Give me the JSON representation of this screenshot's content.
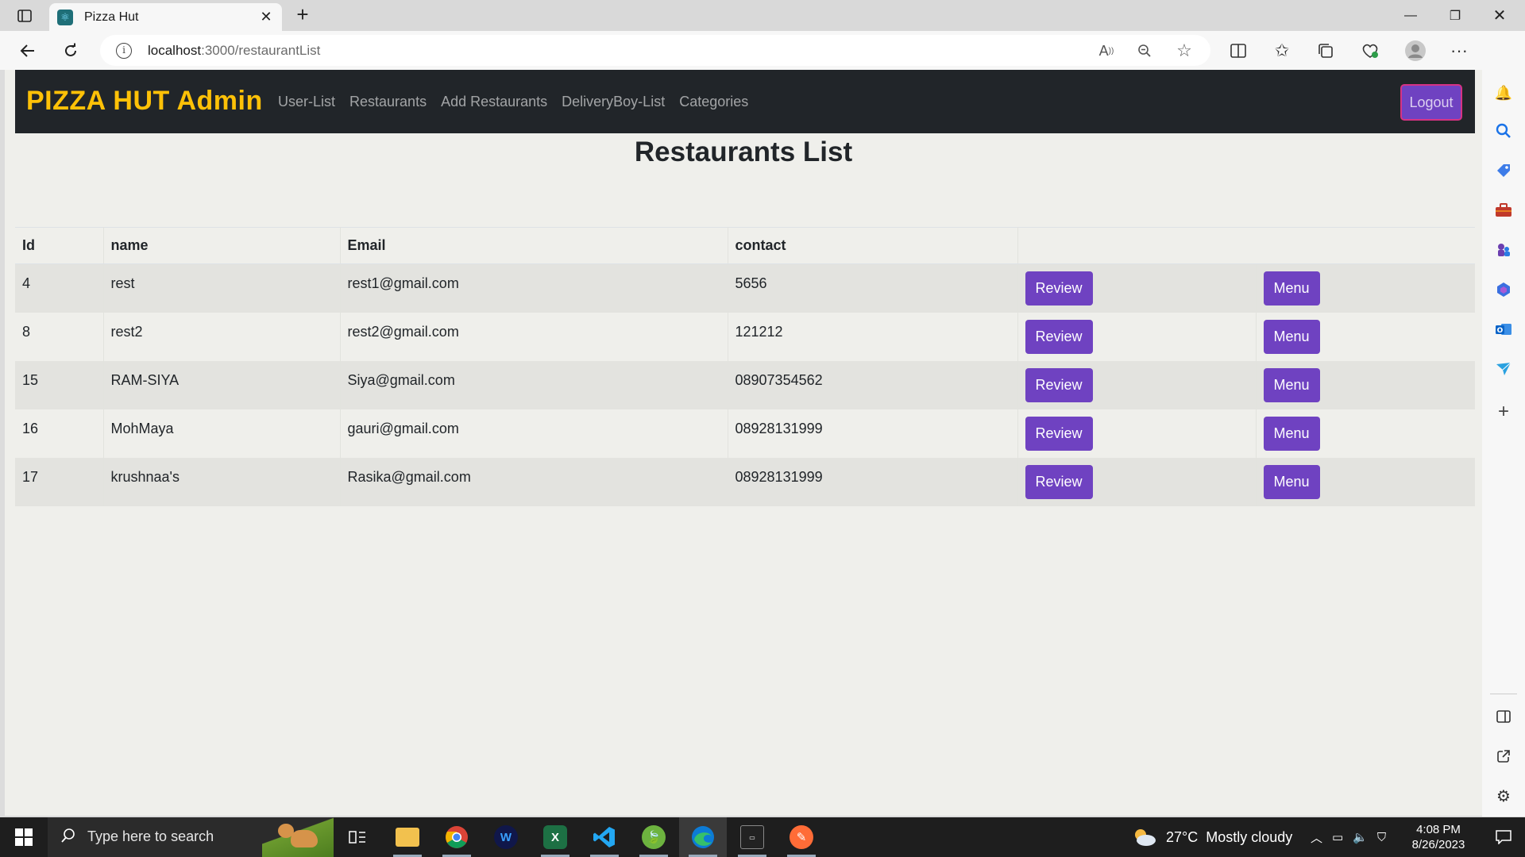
{
  "browser": {
    "tab_title": "Pizza Hut",
    "url_host": "localhost",
    "url_path": ":3000/restaurantList"
  },
  "navbar": {
    "brand": "PIZZA HUT Admin",
    "links": [
      "User-List",
      "Restaurants",
      "Add Restaurants",
      "DeliveryBoy-List",
      "Categories"
    ],
    "logout_label": "Logout"
  },
  "page": {
    "title": "Restaurants List"
  },
  "table": {
    "headers": [
      "Id",
      "name",
      "Email",
      "contact",
      ""
    ],
    "rows": [
      {
        "id": "4",
        "name": "rest",
        "email": "rest1@gmail.com",
        "contact": "5656"
      },
      {
        "id": "8",
        "name": "rest2",
        "email": "rest2@gmail.com",
        "contact": "121212"
      },
      {
        "id": "15",
        "name": "RAM-SIYA",
        "email": "Siya@gmail.com",
        "contact": "08907354562"
      },
      {
        "id": "16",
        "name": "MohMaya",
        "email": "gauri@gmail.com",
        "contact": "08928131999"
      },
      {
        "id": "17",
        "name": "krushnaa's",
        "email": "Rasika@gmail.com",
        "contact": "08928131999"
      }
    ],
    "review_label": "Review",
    "menu_label": "Menu"
  },
  "taskbar": {
    "search_placeholder": "Type here to search",
    "weather_temp": "27°C",
    "weather_desc": "Mostly cloudy",
    "time": "4:08 PM",
    "date": "8/26/2023"
  },
  "colors": {
    "navbar_bg": "#212529",
    "brand": "#ffc107",
    "button": "#6f42c1",
    "logout_border": "#d63384",
    "page_bg": "#efefeb"
  }
}
